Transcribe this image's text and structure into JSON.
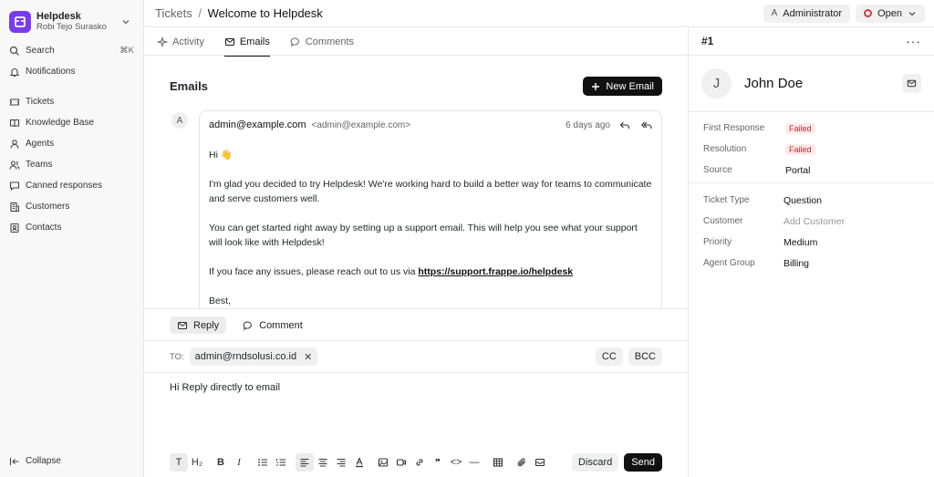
{
  "app": {
    "name": "Helpdesk",
    "user": "Robi Tejo Surasko"
  },
  "sidebar": {
    "search": {
      "label": "Search",
      "shortcut": "⌘K"
    },
    "notifications": "Notifications",
    "items": [
      {
        "label": "Tickets",
        "icon": "ticket-icon"
      },
      {
        "label": "Knowledge Base",
        "icon": "book-icon"
      },
      {
        "label": "Agents",
        "icon": "user-icon"
      },
      {
        "label": "Teams",
        "icon": "users-icon"
      },
      {
        "label": "Canned responses",
        "icon": "message-icon"
      },
      {
        "label": "Customers",
        "icon": "building-icon"
      },
      {
        "label": "Contacts",
        "icon": "contact-icon"
      }
    ],
    "collapse": "Collapse"
  },
  "breadcrumb": {
    "parent": "Tickets",
    "separator": "/",
    "current": "Welcome to Helpdesk"
  },
  "topbar": {
    "assignee_initial": "A",
    "assignee": "Administrator",
    "status": "Open",
    "status_color": "#e03636"
  },
  "tabs": [
    {
      "label": "Activity",
      "active": false
    },
    {
      "label": "Emails",
      "active": true
    },
    {
      "label": "Comments",
      "active": false
    }
  ],
  "emails": {
    "title": "Emails",
    "new_email": "New Email",
    "item": {
      "avatar": "A",
      "sender": "admin@example.com",
      "sender_addr": "<admin@example.com>",
      "time": "6 days ago",
      "greeting": "Hi 👋",
      "p1": "I'm glad you decided to try Helpdesk! We're working hard to build a better way for teams to communicate and serve customers well.",
      "p2": "You can get started right away by setting up a support email. This will help you see what your support will look like with Helpdesk!",
      "p3_prefix": "If you face any issues, please reach out to us via ",
      "p3_link": "https://support.frappe.io/helpdesk",
      "sign": "Best,"
    }
  },
  "reply": {
    "tab_reply": "Reply",
    "tab_comment": "Comment",
    "to_label": "TO:",
    "to_chip": "admin@rndsolusi.co.id",
    "cc": "CC",
    "bcc": "BCC",
    "body": "Hi Reply directly to email",
    "discard": "Discard",
    "send": "Send",
    "toolbar": {
      "text": "T",
      "heading": "H₂",
      "bold": "B",
      "italic": "I",
      "quote": "❞",
      "code": "<>",
      "hr": "—"
    }
  },
  "ticket": {
    "number": "#1",
    "contact_initial": "J",
    "contact_name": "John Doe",
    "sla": [
      {
        "label": "First Response",
        "value": "Failed"
      },
      {
        "label": "Resolution",
        "value": "Failed"
      }
    ],
    "source": {
      "label": "Source",
      "value": "Portal"
    },
    "fields": [
      {
        "label": "Ticket Type",
        "value": "Question"
      },
      {
        "label": "Customer",
        "value": "Add Customer"
      },
      {
        "label": "Priority",
        "value": "Medium"
      },
      {
        "label": "Agent Group",
        "value": "Billing"
      }
    ]
  }
}
